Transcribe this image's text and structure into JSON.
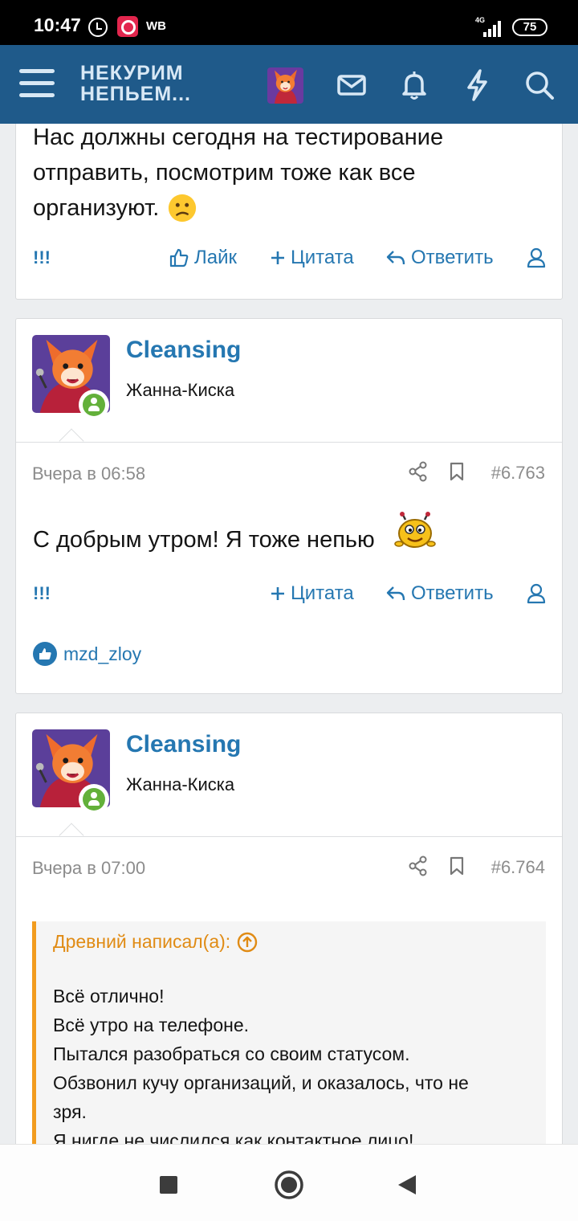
{
  "status_bar": {
    "time": "10:47",
    "notification_label": "WB",
    "network": "4G",
    "battery": "75"
  },
  "header": {
    "logo_line1": "НЕКУРИМ",
    "logo_line2": "НЕПЬЕМ...",
    "icons": [
      "menu-icon",
      "avatar",
      "mail-icon",
      "bell-icon",
      "bolt-icon",
      "search-icon"
    ]
  },
  "posts": [
    {
      "text_lines": [
        "Нас должны сегодня на тестирование",
        "отправить, посмотрим тоже как все",
        "организуют."
      ],
      "emoji": "confused-emoji",
      "actions": {
        "bang": "!!!",
        "like": "Лайк",
        "quote": "Цитата",
        "reply": "Ответить"
      }
    },
    {
      "username": "Cleansing",
      "user_title": "Жанна-Киска",
      "date": "Вчера в 06:58",
      "post_number": "#6.763",
      "text": "С добрым утром! Я тоже непью",
      "emoji": "smiley-bug-emoji",
      "actions": {
        "bang": "!!!",
        "quote": "Цитата",
        "reply": "Ответить"
      },
      "reactions_user": "mzd_zloy"
    },
    {
      "username": "Cleansing",
      "user_title": "Жанна-Киска",
      "date": "Вчера в 07:00",
      "post_number": "#6.764",
      "quote": {
        "author": "Древний написал(а):",
        "lines": [
          "Всё отлично!",
          "Всё утро на телефоне.",
          "Пытался разобраться со своим статусом.",
          "Обзвонил кучу организаций, и оказалось, что не",
          "зря.",
          "Я нигде не числился как контактное лицо!"
        ]
      }
    }
  ],
  "colors": {
    "header_bg": "#1f5a8a",
    "link": "#2577b1",
    "quote_accent": "#f29c1f",
    "online": "#63b03a"
  }
}
